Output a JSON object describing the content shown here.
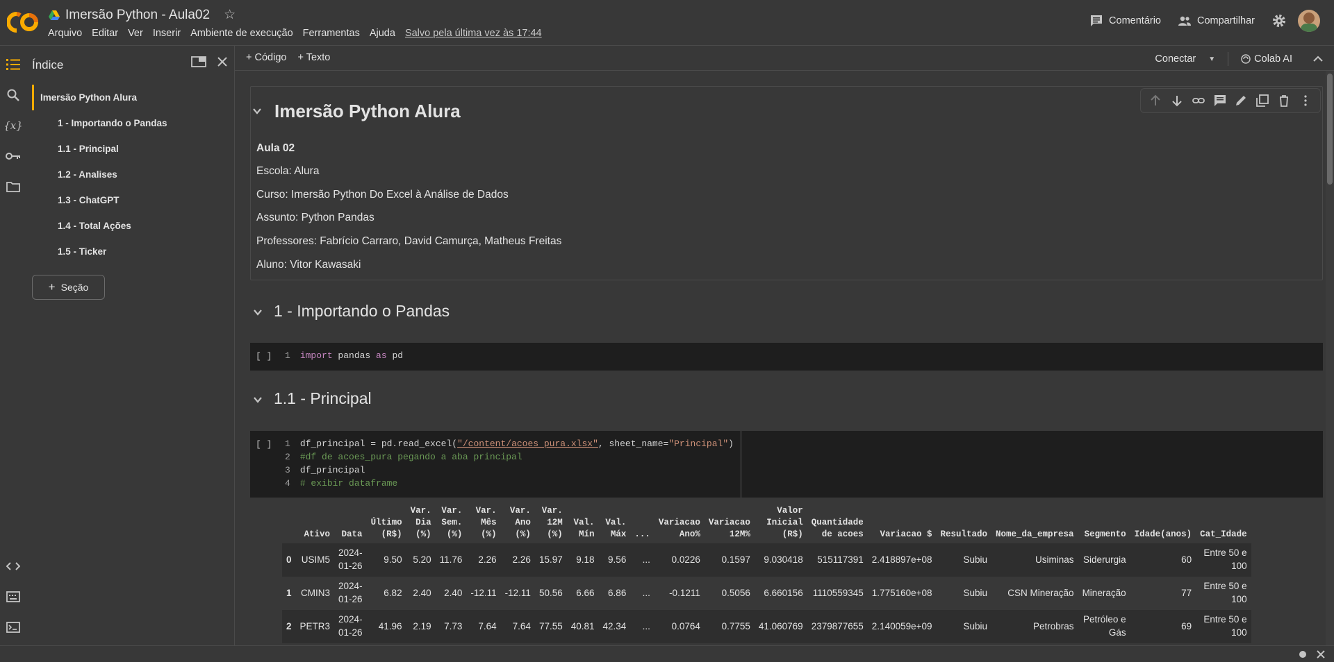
{
  "header": {
    "title": "Imersão Python - Aula02",
    "menu": [
      "Arquivo",
      "Editar",
      "Ver",
      "Inserir",
      "Ambiente de execução",
      "Ferramentas",
      "Ajuda"
    ],
    "saved": "Salvo pela última vez às 17:44",
    "comment": "Comentário",
    "share": "Compartilhar"
  },
  "toc": {
    "title": "Índice",
    "items": [
      "Imersão Python Alura",
      "1 - Importando o Pandas",
      "1.1 - Principal",
      "1.2 - Analises",
      "1.3 - ChatGPT",
      "1.4 - Total Ações",
      "1.5 - Ticker"
    ],
    "section_btn": "Seção"
  },
  "toolbar": {
    "code": "Código",
    "text": "Texto",
    "connect": "Conectar",
    "colab_ai": "Colab AI"
  },
  "notebook": {
    "h1": "Imersão Python Alura",
    "lesson": "Aula 02",
    "lines": [
      "Escola: Alura",
      "Curso: Imersão Python Do Excel à Análise de Dados",
      "Assunto: Python Pandas",
      "Professores: Fabrício Carraro, David Camurça, Matheus Freitas",
      "Aluno: Vitor Kawasaki"
    ],
    "h2_1": "1 - Importando o Pandas",
    "h2_2": "1.1 - Principal",
    "run_mark": "[ ]",
    "code1": {
      "n": "1",
      "kw1": "import",
      "mid": " pandas ",
      "kw2": "as",
      "end": " pd"
    },
    "code2": [
      {
        "n": "1",
        "a": "df_principal = pd.read_excel(",
        "s1": "\"/content/acoes_pura.xlsx\"",
        "b": ", sheet_name=",
        "s2": "\"Principal\"",
        "c": ")"
      },
      {
        "n": "2",
        "cm": "#df de acoes_pura pegando a aba principal"
      },
      {
        "n": "3",
        "a": "df_principal"
      },
      {
        "n": "4",
        "cm": "# exibir dataframe"
      }
    ]
  },
  "dataframe": {
    "headers": [
      [
        "Ativo"
      ],
      [
        "Data"
      ],
      [
        "Último",
        "(R$)"
      ],
      [
        "Var.",
        "Dia",
        "(%)"
      ],
      [
        "Var.",
        "Sem.",
        "(%)"
      ],
      [
        "Var.",
        "Mês",
        "(%)"
      ],
      [
        "Var.",
        "Ano",
        "(%)"
      ],
      [
        "Var.",
        "12M",
        "(%)"
      ],
      [
        "Val.",
        "Mín"
      ],
      [
        "Val.",
        "Máx"
      ],
      [
        "..."
      ],
      [
        "Variacao",
        "Ano%"
      ],
      [
        "Variacao",
        "12M%"
      ],
      [
        "Valor",
        "Inicial",
        "(R$)"
      ],
      [
        "Quantidade",
        "de acoes"
      ],
      [
        "Variacao $"
      ],
      [
        "Resultado"
      ],
      [
        "Nome_da_empresa"
      ],
      [
        "Segmento"
      ],
      [
        "Idade(anos)"
      ],
      [
        "Cat_Idade"
      ]
    ],
    "rows": [
      [
        "0",
        "USIM5",
        "2024-\n01-26",
        "9.50",
        "5.20",
        "11.76",
        "2.26",
        "2.26",
        "15.97",
        "9.18",
        "9.56",
        "...",
        "0.0226",
        "0.1597",
        "9.030418",
        "515117391",
        "2.418897e+08",
        "Subiu",
        "Usiminas",
        "Siderurgia",
        "60",
        "Entre 50 e\n100"
      ],
      [
        "1",
        "CMIN3",
        "2024-\n01-26",
        "6.82",
        "2.40",
        "2.40",
        "-12.11",
        "-12.11",
        "50.56",
        "6.66",
        "6.86",
        "...",
        "-0.1211",
        "0.5056",
        "6.660156",
        "1110559345",
        "1.775160e+08",
        "Subiu",
        "CSN Mineração",
        "Mineração",
        "77",
        "Entre 50 e\n100"
      ],
      [
        "2",
        "PETR3",
        "2024-\n01-26",
        "41.96",
        "2.19",
        "7.73",
        "7.64",
        "7.64",
        "77.55",
        "40.81",
        "42.34",
        "...",
        "0.0764",
        "0.7755",
        "41.060769",
        "2379877655",
        "2.140059e+09",
        "Subiu",
        "Petrobras",
        "Petróleo e\nGás",
        "69",
        "Entre 50 e\n100"
      ]
    ]
  }
}
